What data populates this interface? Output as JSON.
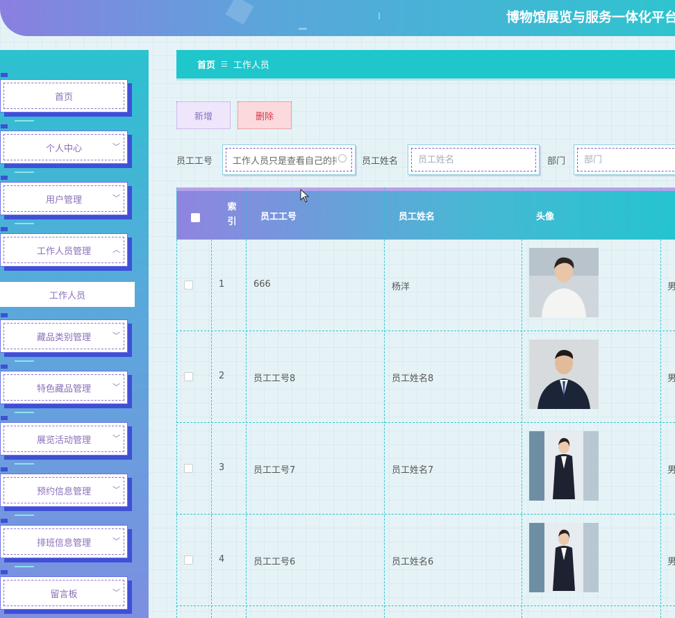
{
  "header": {
    "title": "博物馆展览与服务一体化平台"
  },
  "sidebar": {
    "items": [
      {
        "label": "首页"
      },
      {
        "label": "个人中心"
      },
      {
        "label": "用户管理"
      },
      {
        "label": "工作人员管理"
      },
      {
        "label": "藏品类别管理"
      },
      {
        "label": "特色藏品管理"
      },
      {
        "label": "展览活动管理"
      },
      {
        "label": "预约信息管理"
      },
      {
        "label": "排班信息管理"
      },
      {
        "label": "留言板"
      }
    ],
    "sub_item": "工作人员"
  },
  "breadcrumb": {
    "home": "首页",
    "separator": "☰",
    "current": "工作人员"
  },
  "toolbar": {
    "add_label": "新增",
    "delete_label": "删除"
  },
  "search": {
    "id_label": "员工工号",
    "id_value": "工作人员只是查看自己的排",
    "name_label": "员工姓名",
    "name_placeholder": "员工姓名",
    "dept_label": "部门",
    "dept_placeholder": "部门"
  },
  "table": {
    "headers": {
      "index": "索引",
      "id": "员工工号",
      "name": "员工姓名",
      "avatar": "头像"
    },
    "rows": [
      {
        "index": "1",
        "id": "666",
        "name": "杨洋",
        "gender": "男"
      },
      {
        "index": "2",
        "id": "员工工号8",
        "name": "员工姓名8",
        "gender": "男"
      },
      {
        "index": "3",
        "id": "员工工号7",
        "name": "员工姓名7",
        "gender": "男"
      },
      {
        "index": "4",
        "id": "员工工号6",
        "name": "员工姓名6",
        "gender": "男"
      }
    ]
  },
  "colors": {
    "accent": "#1fc6cc",
    "sidebar_top": "#2bc2cf",
    "sidebar_bottom": "#7d8fe0",
    "delete": "#d43a4a"
  }
}
